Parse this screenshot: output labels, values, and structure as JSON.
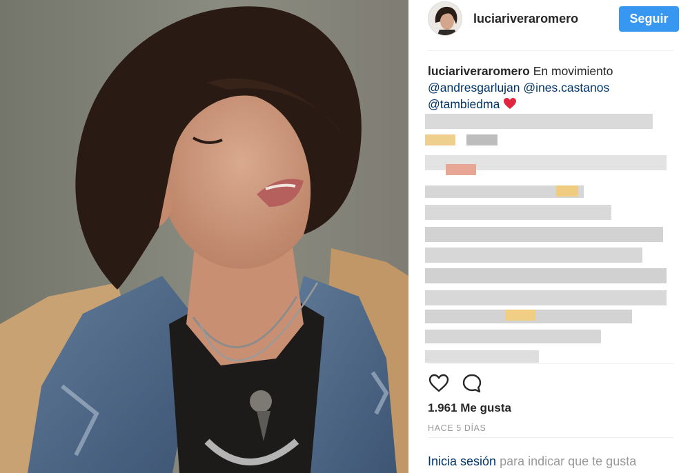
{
  "post": {
    "username": "luciariveraromero",
    "follow_label": "Seguir",
    "caption": {
      "username": "luciariveraromero",
      "text": "En movimiento",
      "mentions": [
        "@andresgarlujan",
        "@ines.castanos",
        "@tambiedma"
      ],
      "emoji": "red-heart"
    },
    "likes": "1.961 Me gusta",
    "timestamp": "HACE 5 DÍAS",
    "login_link": "Inicia sesión",
    "login_text": "para indicar que te gusta"
  },
  "icons": {
    "like": "heart-outline-icon",
    "comment": "comment-bubble-icon"
  },
  "colors": {
    "follow_button": "#3897f0",
    "link": "#003569",
    "muted_text": "#999999",
    "emoji_heart": "#e0263e"
  }
}
